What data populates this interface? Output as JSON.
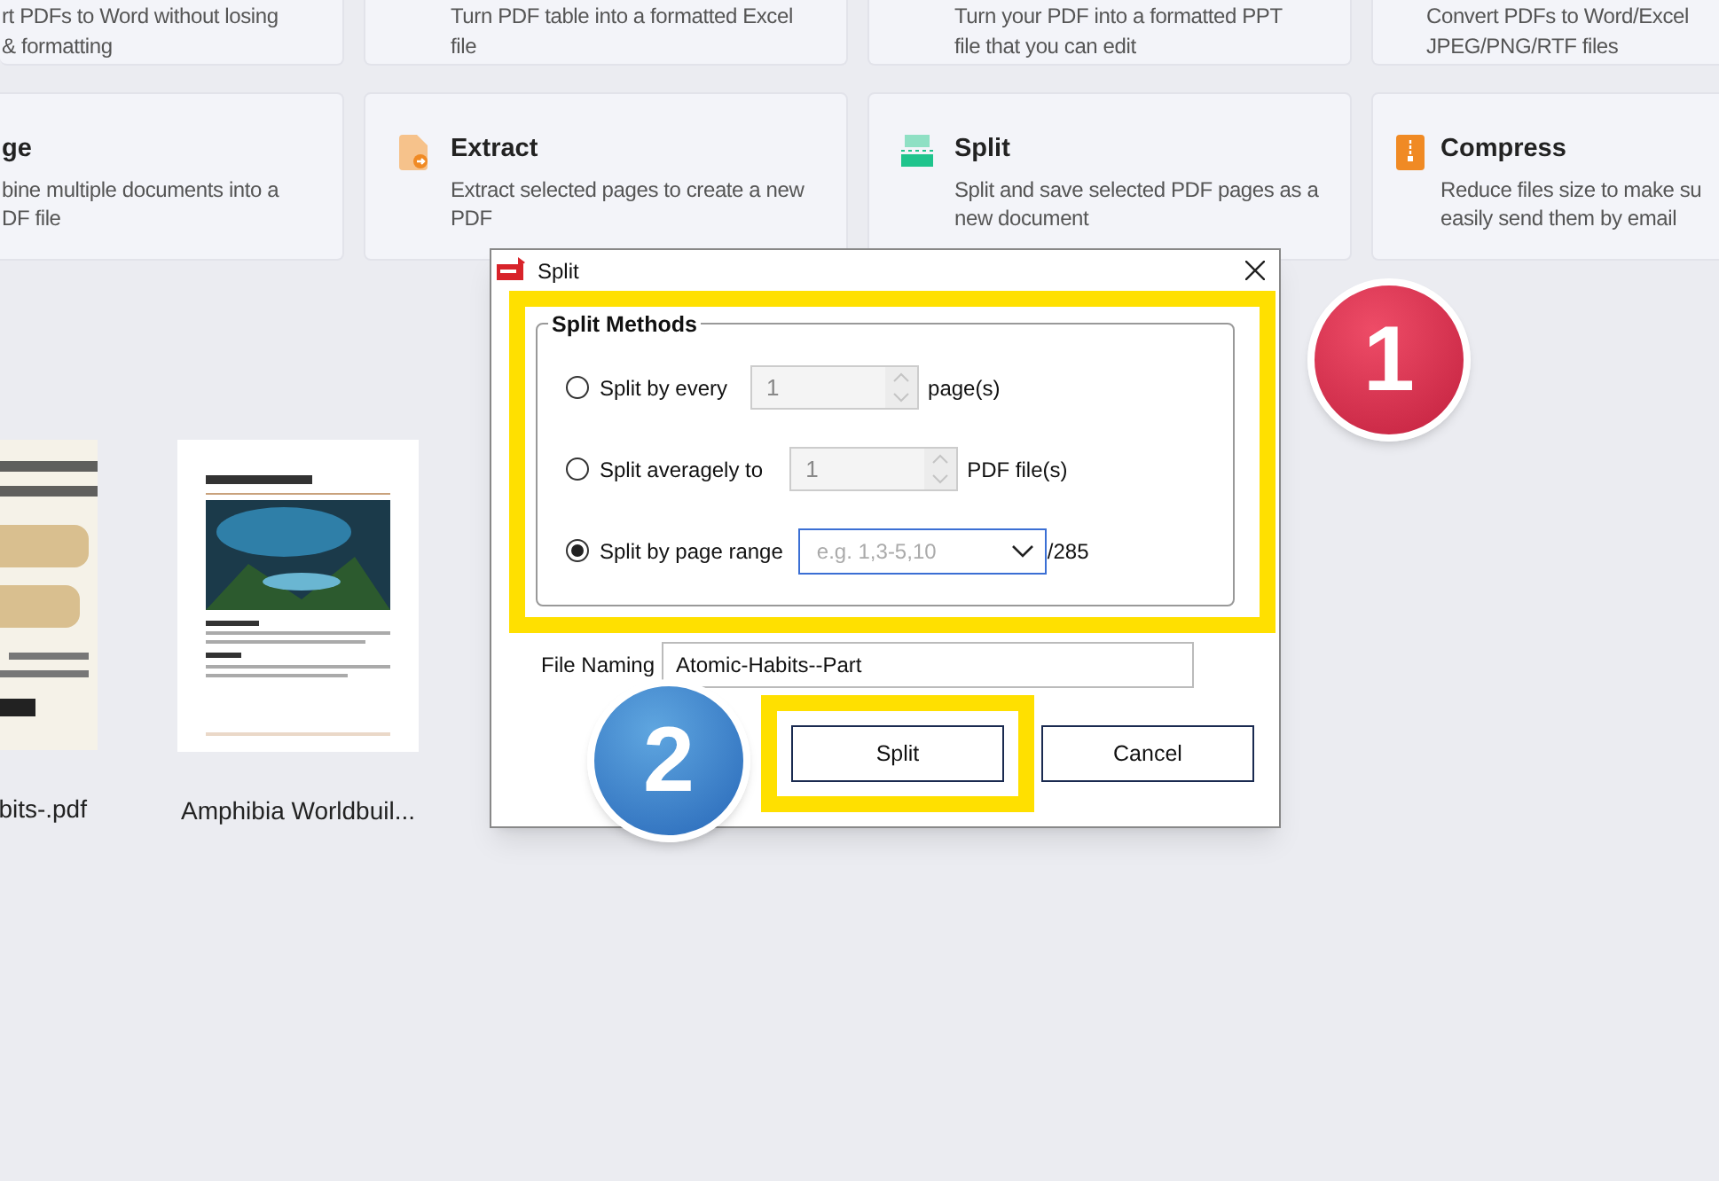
{
  "tool_cards_top": [
    {
      "lines": [
        "rt PDFs to Word without losing",
        "& formatting"
      ]
    },
    {
      "lines": [
        "Turn PDF table into a formatted Excel",
        "file"
      ]
    },
    {
      "lines": [
        "Turn your PDF into a formatted PPT",
        "file that you can edit"
      ]
    },
    {
      "lines": [
        "Convert PDFs to Word/Excel",
        "JPEG/PNG/RTF files"
      ]
    }
  ],
  "tool_cards": [
    {
      "title": "ge",
      "lines": [
        "bine multiple documents into a",
        "DF file"
      ]
    },
    {
      "kind": "extract",
      "title": "Extract",
      "lines": [
        "Extract selected pages to create a new",
        "PDF"
      ]
    },
    {
      "kind": "split",
      "title": "Split",
      "lines": [
        "Split and save selected PDF pages as a",
        "new document"
      ]
    },
    {
      "kind": "compress",
      "title": "Compress",
      "lines": [
        "Reduce files size to make su",
        "easily send them by email"
      ]
    }
  ],
  "files": [
    {
      "kind": "picture",
      "name": "bits-.pdf"
    },
    {
      "kind": "picture",
      "name": "Amphibia Worldbuil..."
    }
  ],
  "dialog": {
    "title": "Split",
    "group_title": "Split Methods",
    "methods": [
      {
        "kind": "spinner",
        "label": "Split by every",
        "value": "1",
        "unit": "page(s)",
        "selected": false
      },
      {
        "kind": "spinner",
        "label": "Split averagely to",
        "value": "1",
        "unit": "PDF file(s)",
        "selected": false
      },
      {
        "kind": "dropdown",
        "label": "Split by page range",
        "placeholder": "e.g. 1,3-5,10",
        "unit": "/285",
        "selected": true
      }
    ],
    "file_naming": {
      "label": "File Naming",
      "value": "Atomic-Habits--Part"
    },
    "buttons": [
      {
        "label": "Split",
        "highlighted": true
      },
      {
        "label": "Cancel",
        "highlighted": false
      }
    ]
  },
  "annotations": [
    {
      "label": "1"
    },
    {
      "label": "2"
    }
  ]
}
